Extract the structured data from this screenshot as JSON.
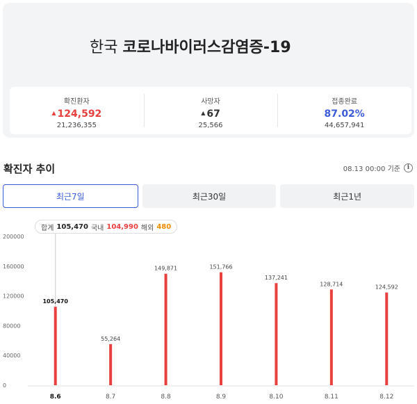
{
  "header": {
    "title_light": "한국",
    "title_bold": "코로나바이러스감염증-19"
  },
  "stats": [
    {
      "label": "확진환자",
      "value": "124,592",
      "arrow": "▲",
      "sub": "21,236,355",
      "color": "#e8403f"
    },
    {
      "label": "사망자",
      "value": "67",
      "arrow": "▲",
      "sub": "25,566",
      "color": "#333333"
    },
    {
      "label": "접종완료",
      "value": "87.02%",
      "arrow": "",
      "sub": "44,657,941",
      "color": "#3b5bdb"
    }
  ],
  "section": {
    "title": "확진자 추이",
    "updated": "08.13 00:00 기준",
    "info_icon": "info-icon"
  },
  "tabs": [
    {
      "label": "최근7일",
      "active": true
    },
    {
      "label": "최근30일",
      "active": false
    },
    {
      "label": "최근1년",
      "active": false
    }
  ],
  "tooltip": {
    "total_label": "합계",
    "total_value": "105,470",
    "domestic_label": "국내",
    "domestic_value": "104,990",
    "overseas_label": "해외",
    "overseas_value": "480"
  },
  "chart_data": {
    "type": "bar",
    "categories": [
      "8.6",
      "8.7",
      "8.8",
      "8.9",
      "8.10",
      "8.11",
      "8.12"
    ],
    "values": [
      105470,
      55264,
      149871,
      151766,
      137241,
      128714,
      124592
    ],
    "value_labels": [
      "105,470",
      "55,264",
      "149,871",
      "151,766",
      "137,241",
      "128,714",
      "124,592"
    ],
    "y_ticks": [
      "0",
      "40000",
      "80000",
      "120000",
      "160000",
      "200000"
    ],
    "ylim": [
      0,
      200000
    ],
    "selected_index": 0,
    "bar_color": "#e8403f",
    "grid": false
  }
}
